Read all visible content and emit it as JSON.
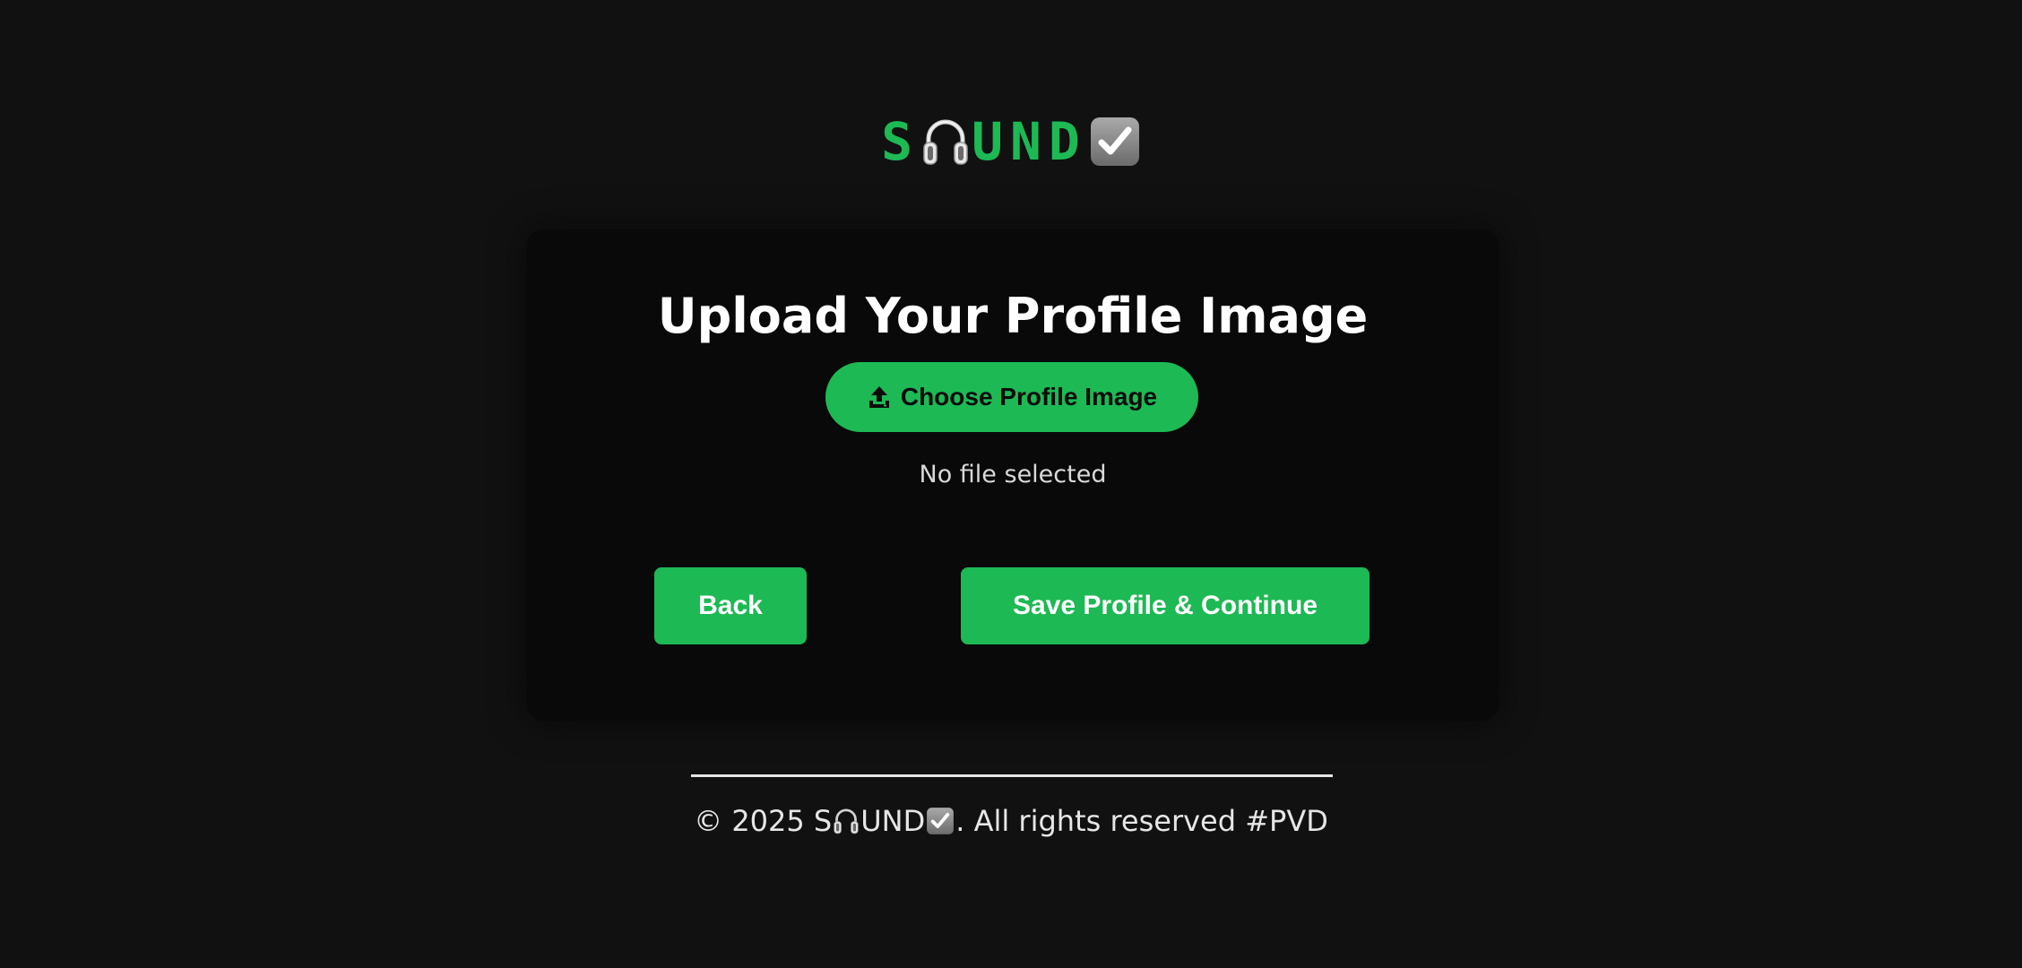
{
  "brand": {
    "letter_s": "S",
    "letters_und": "UND",
    "o_icon": "headphones-icon",
    "check_icon": "check-box-icon",
    "color": "#1db954"
  },
  "card": {
    "title": "Upload Your Profile Image",
    "choose_button": {
      "label": "Choose Profile Image",
      "icon": "upload-icon"
    },
    "file_status": "No file selected",
    "back_label": "Back",
    "save_label": "Save Profile & Continue"
  },
  "footer": {
    "prefix": "© 2025 S",
    "brand_und": "UND",
    "suffix": ". All rights reserved #PVD"
  },
  "colors": {
    "background": "#111111",
    "card": "#090909",
    "accent": "#1db954"
  }
}
